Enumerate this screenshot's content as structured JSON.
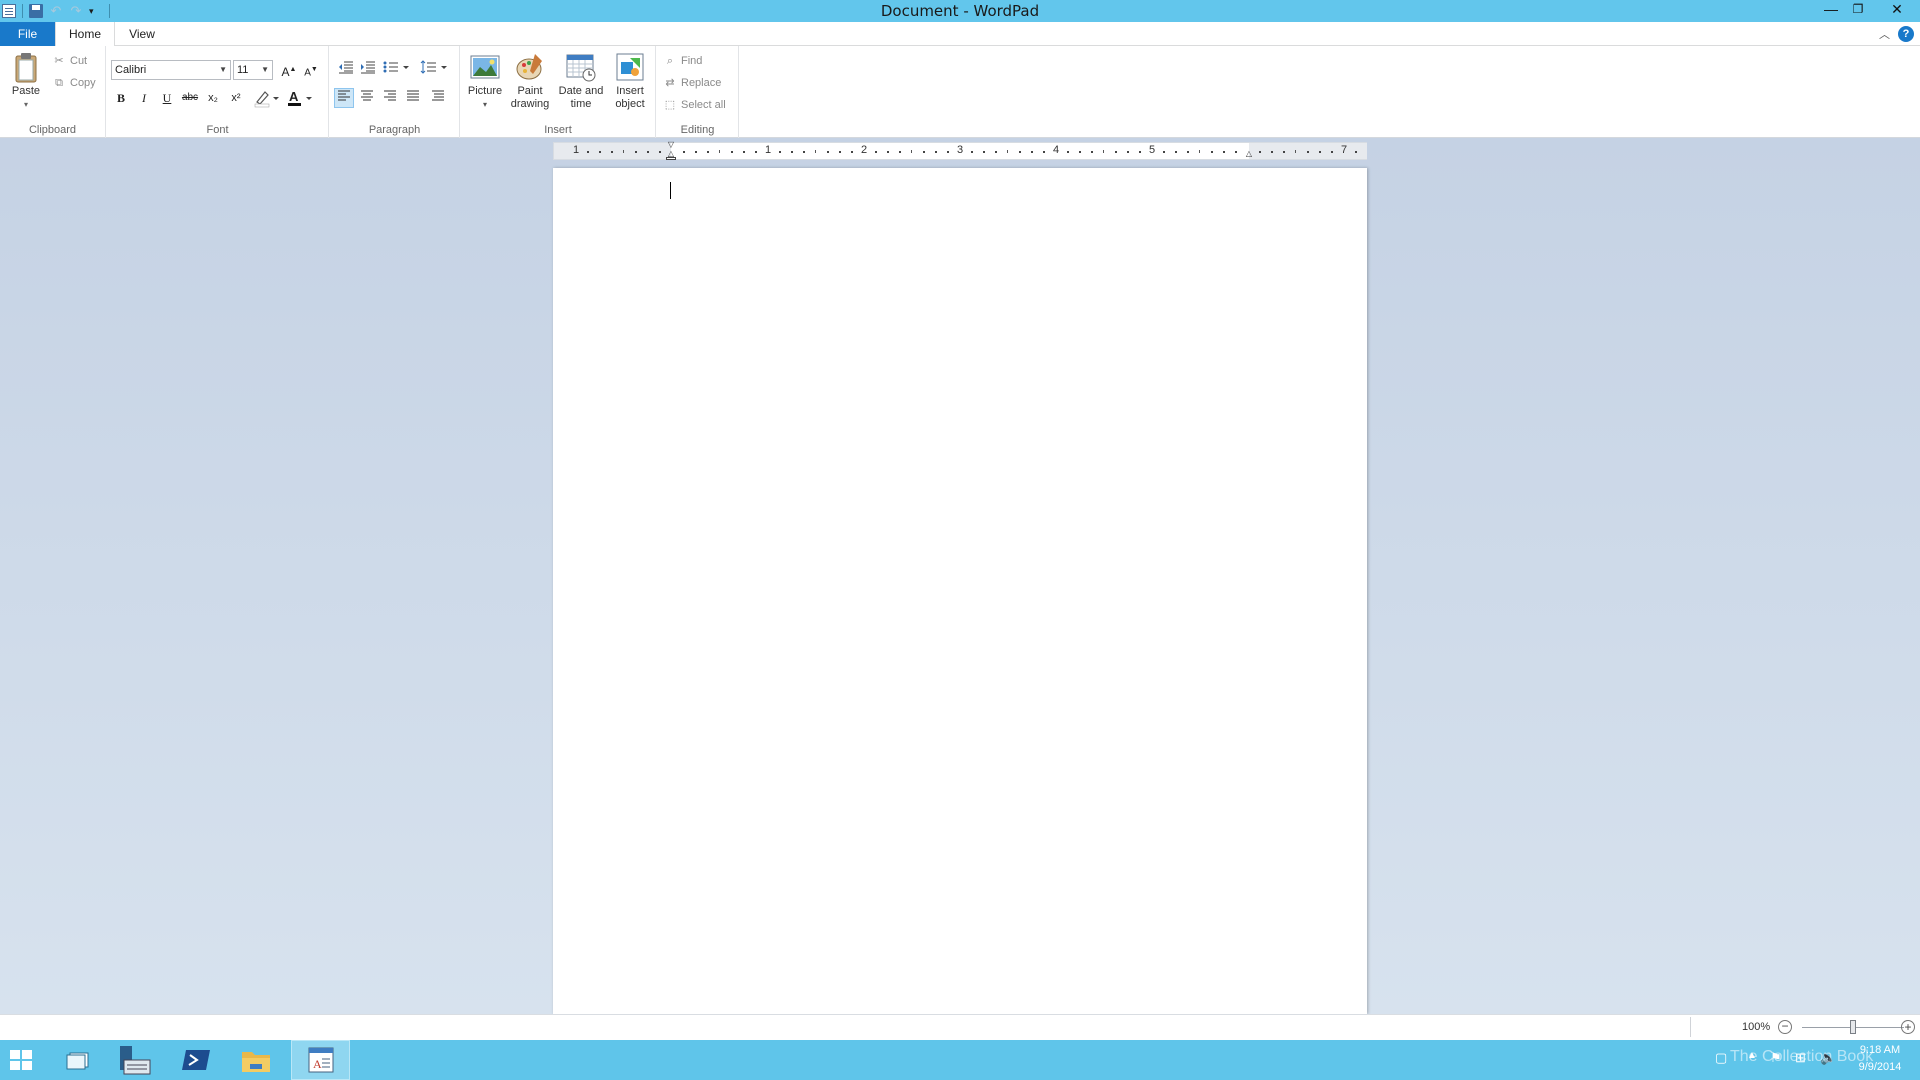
{
  "window": {
    "title": "Document - WordPad",
    "controls": {
      "minimize": "—",
      "restore": "❐",
      "close": "✕"
    }
  },
  "tabs": {
    "file": "File",
    "home": "Home",
    "view": "View",
    "help": "?"
  },
  "ribbon": {
    "clipboard": {
      "label": "Clipboard",
      "paste": "Paste",
      "cut": "Cut",
      "copy": "Copy"
    },
    "font": {
      "label": "Font",
      "family": "Calibri",
      "size": "11",
      "bold": "B",
      "italic": "I",
      "underline": "U",
      "strike": "abc",
      "subscript": "x₂",
      "superscript": "x²"
    },
    "paragraph": {
      "label": "Paragraph"
    },
    "insert": {
      "label": "Insert",
      "picture": "Picture",
      "paint_drawing_1": "Paint",
      "paint_drawing_2": "drawing",
      "date_time_1": "Date and",
      "date_time_2": "time",
      "insert_object_1": "Insert",
      "insert_object_2": "object"
    },
    "editing": {
      "label": "Editing",
      "find": "Find",
      "replace": "Replace",
      "select_all": "Select all"
    }
  },
  "ruler": {
    "numbers": [
      "1",
      "1",
      "2",
      "3",
      "4",
      "5",
      "7"
    ]
  },
  "status": {
    "zoom": "100%",
    "zoom_level_fraction": 0.5
  },
  "taskbar": {
    "clock_time": "9:18 AM",
    "clock_date": "9/9/2014",
    "watermark": "The Collection Book"
  },
  "colors": {
    "titlebar": "#62c6ec",
    "file_tab": "#1979ca",
    "taskbar": "#5fc5ea"
  }
}
